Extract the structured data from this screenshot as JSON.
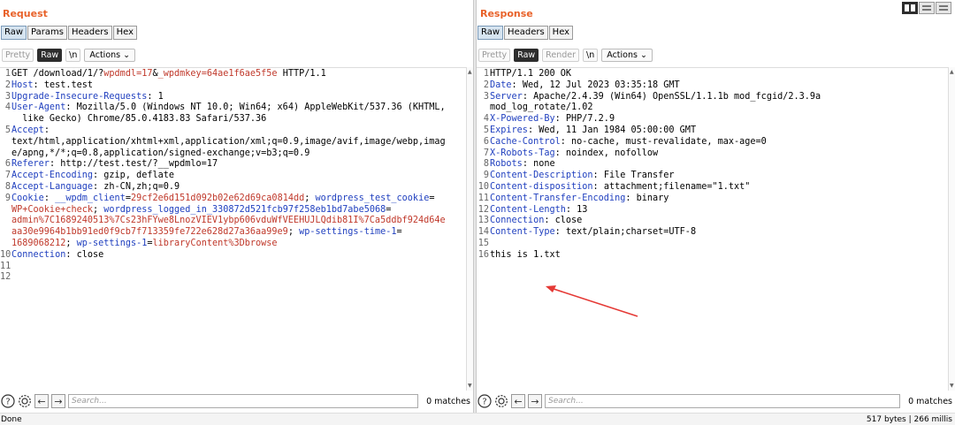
{
  "request": {
    "title": "Request",
    "tabs": [
      "Raw",
      "Params",
      "Headers",
      "Hex"
    ],
    "toolbar": {
      "pretty": "Pretty",
      "raw": "Raw",
      "newline": "\\n",
      "actions": "Actions"
    },
    "search_placeholder": "Search...",
    "matches": "0 matches",
    "lines": [
      {
        "n": "1",
        "parts": [
          [
            "t",
            "GET /download/1/?"
          ],
          [
            "r",
            "wpdmdl=17"
          ],
          [
            "t",
            "&"
          ],
          [
            "r",
            "_wpdmkey=64ae1f6ae5f5e"
          ],
          [
            "t",
            " HTTP/1.1"
          ]
        ]
      },
      {
        "n": "2",
        "parts": [
          [
            "h",
            "Host"
          ],
          [
            "t",
            ": test.test"
          ]
        ]
      },
      {
        "n": "3",
        "parts": [
          [
            "h",
            "Upgrade-Insecure-Requests"
          ],
          [
            "t",
            ": 1"
          ]
        ]
      },
      {
        "n": "4",
        "parts": [
          [
            "h",
            "User-Agent"
          ],
          [
            "t",
            ": Mozilla/5.0 (Windows NT 10.0; Win64; x64) AppleWebKit/537.36 (KHTML,"
          ]
        ]
      },
      {
        "n": "",
        "parts": [
          [
            "t",
            "  like Gecko) Chrome/85.0.4183.83 Safari/537.36"
          ]
        ]
      },
      {
        "n": "5",
        "parts": [
          [
            "h",
            "Accept"
          ],
          [
            "t",
            ":"
          ]
        ]
      },
      {
        "n": "",
        "parts": [
          [
            "t",
            "text/html,application/xhtml+xml,application/xml;q=0.9,image/avif,image/webp,imag"
          ]
        ]
      },
      {
        "n": "",
        "parts": [
          [
            "t",
            "e/apng,*/*;q=0.8,application/signed-exchange;v=b3;q=0.9"
          ]
        ]
      },
      {
        "n": "6",
        "parts": [
          [
            "h",
            "Referer"
          ],
          [
            "t",
            ": http://test.test/?__wpdmlo=17"
          ]
        ]
      },
      {
        "n": "7",
        "parts": [
          [
            "h",
            "Accept-Encoding"
          ],
          [
            "t",
            ": gzip, deflate"
          ]
        ]
      },
      {
        "n": "8",
        "parts": [
          [
            "h",
            "Accept-Language"
          ],
          [
            "t",
            ": zh-CN,zh;q=0.9"
          ]
        ]
      },
      {
        "n": "9",
        "parts": [
          [
            "h",
            "Cookie"
          ],
          [
            "t",
            ": "
          ],
          [
            "b",
            "__wpdm_client"
          ],
          [
            "t",
            "="
          ],
          [
            "r",
            "29cf2e6d151d092b02e62d69ca0814dd"
          ],
          [
            "t",
            "; "
          ],
          [
            "b",
            "wordpress_test_cookie"
          ],
          [
            "t",
            "="
          ]
        ]
      },
      {
        "n": "",
        "parts": [
          [
            "r",
            "WP+Cookie+check"
          ],
          [
            "t",
            "; "
          ],
          [
            "b",
            "wordpress_logged_in_330872d521fcb97f258eb1bd7abe5068"
          ],
          [
            "t",
            "="
          ]
        ]
      },
      {
        "n": "",
        "parts": [
          [
            "r",
            "admin%7C1689240513%7Cs23hFYwe8LnozVIEV1ybp606vduWfVEEHUJLQdib81I%7Ca5ddbf924d64e"
          ]
        ]
      },
      {
        "n": "",
        "parts": [
          [
            "r",
            "aa30e9964b1bb91ed0f9cb7f713359fe722e628d27a36aa99e9"
          ],
          [
            "t",
            "; "
          ],
          [
            "b",
            "wp-settings-time-1"
          ],
          [
            "t",
            "="
          ]
        ]
      },
      {
        "n": "",
        "parts": [
          [
            "r",
            "1689068212"
          ],
          [
            "t",
            "; "
          ],
          [
            "b",
            "wp-settings-1"
          ],
          [
            "t",
            "="
          ],
          [
            "r",
            "libraryContent%3Dbrowse"
          ]
        ]
      },
      {
        "n": "10",
        "parts": [
          [
            "h",
            "Connection"
          ],
          [
            "t",
            ": close"
          ]
        ]
      },
      {
        "n": "11",
        "parts": []
      },
      {
        "n": "12",
        "parts": []
      }
    ]
  },
  "response": {
    "title": "Response",
    "tabs": [
      "Raw",
      "Headers",
      "Hex"
    ],
    "toolbar": {
      "pretty": "Pretty",
      "raw": "Raw",
      "render": "Render",
      "newline": "\\n",
      "actions": "Actions"
    },
    "search_placeholder": "Search...",
    "matches": "0 matches",
    "lines": [
      {
        "n": "1",
        "parts": [
          [
            "t",
            "HTTP/1.1 200 OK"
          ]
        ]
      },
      {
        "n": "2",
        "parts": [
          [
            "h",
            "Date"
          ],
          [
            "t",
            ": Wed, 12 Jul 2023 03:35:18 GMT"
          ]
        ]
      },
      {
        "n": "3",
        "parts": [
          [
            "h",
            "Server"
          ],
          [
            "t",
            ": Apache/2.4.39 (Win64) OpenSSL/1.1.1b mod_fcgid/2.3.9a"
          ]
        ]
      },
      {
        "n": "",
        "parts": [
          [
            "t",
            "mod_log_rotate/1.02"
          ]
        ]
      },
      {
        "n": "4",
        "parts": [
          [
            "h",
            "X-Powered-By"
          ],
          [
            "t",
            ": PHP/7.2.9"
          ]
        ]
      },
      {
        "n": "5",
        "parts": [
          [
            "h",
            "Expires"
          ],
          [
            "t",
            ": Wed, 11 Jan 1984 05:00:00 GMT"
          ]
        ]
      },
      {
        "n": "6",
        "parts": [
          [
            "h",
            "Cache-Control"
          ],
          [
            "t",
            ": no-cache, must-revalidate, max-age=0"
          ]
        ]
      },
      {
        "n": "7",
        "parts": [
          [
            "h",
            "X-Robots-Tag"
          ],
          [
            "t",
            ": noindex, nofollow"
          ]
        ]
      },
      {
        "n": "8",
        "parts": [
          [
            "h",
            "Robots"
          ],
          [
            "t",
            ": none"
          ]
        ]
      },
      {
        "n": "9",
        "parts": [
          [
            "h",
            "Content-Description"
          ],
          [
            "t",
            ": File Transfer"
          ]
        ]
      },
      {
        "n": "10",
        "parts": [
          [
            "h",
            "Content-disposition"
          ],
          [
            "t",
            ": attachment;filename=\"1.txt\""
          ]
        ]
      },
      {
        "n": "11",
        "parts": [
          [
            "h",
            "Content-Transfer-Encoding"
          ],
          [
            "t",
            ": binary"
          ]
        ]
      },
      {
        "n": "12",
        "parts": [
          [
            "h",
            "Content-Length"
          ],
          [
            "t",
            ": 13"
          ]
        ]
      },
      {
        "n": "13",
        "parts": [
          [
            "h",
            "Connection"
          ],
          [
            "t",
            ": close"
          ]
        ]
      },
      {
        "n": "14",
        "parts": [
          [
            "h",
            "Content-Type"
          ],
          [
            "t",
            ": text/plain;charset=UTF-8"
          ]
        ]
      },
      {
        "n": "15",
        "parts": []
      },
      {
        "n": "16",
        "parts": [
          [
            "t",
            "this is 1.txt"
          ]
        ]
      }
    ]
  },
  "status": {
    "left": "Done",
    "right": "517 bytes | 266 millis"
  },
  "colors": {
    "title": "#e8622a",
    "header_key": "#1f3fbf",
    "value_red": "#c0392b",
    "annotation_arrow": "#e53935"
  },
  "icons": [
    "help-icon",
    "settings-icon",
    "left-arrow-icon",
    "right-arrow-icon",
    "layout-side-by-side-icon",
    "layout-top-bottom-icon",
    "layout-tabs-icon",
    "chevron-down-icon"
  ]
}
